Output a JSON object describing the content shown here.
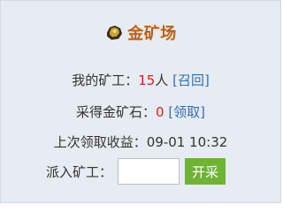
{
  "header": {
    "icon": "gold-ore-icon",
    "title": "金矿场"
  },
  "miners": {
    "label": "我的矿工：",
    "count": "15",
    "unit": "人",
    "recall_link": "[召回]"
  },
  "gold": {
    "label": "采得金矿石：",
    "amount": "0",
    "claim_link": "[领取]"
  },
  "last_claim": {
    "label": "上次领取收益：",
    "time": "09-01 10:32"
  },
  "dispatch": {
    "label": "派入矿工：",
    "input_value": "",
    "button_label": "开采"
  },
  "colors": {
    "title": "#c25d10",
    "highlight_red": "#e02020",
    "link_blue": "#2e6fb6",
    "button_green": "#6fb335",
    "panel_bg": "#e6ecf2"
  }
}
